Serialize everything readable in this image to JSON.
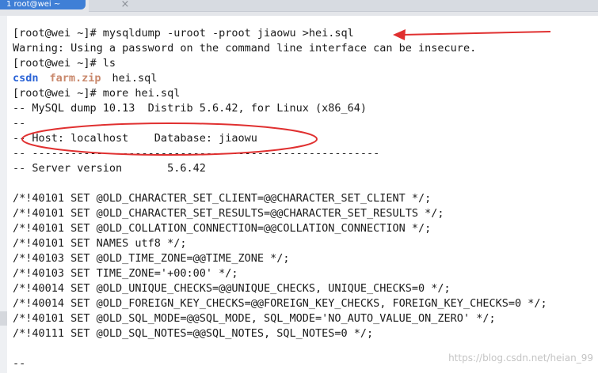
{
  "tabs": [
    {
      "label": "1 root@wei ~"
    }
  ],
  "tab_close_icon": "close-icon",
  "terminal": {
    "lines": [
      {
        "text": "[root@wei ~]# mysqldump -uroot -proot jiaowu >hei.sql"
      },
      {
        "text": "Warning: Using a password on the command line interface can be insecure."
      },
      {
        "text": "[root@wei ~]# ls"
      },
      {
        "ls": [
          {
            "text": "csdn",
            "kind": "directory",
            "color": "#2a63d6"
          },
          {
            "text": "farm.zip",
            "kind": "archive",
            "color": "#c9886c"
          },
          {
            "text": "hei.sql",
            "kind": "file",
            "color": "#1a1a1a"
          }
        ]
      },
      {
        "text": "[root@wei ~]# more hei.sql"
      },
      {
        "text": "-- MySQL dump 10.13  Distrib 5.6.42, for Linux (x86_64)"
      },
      {
        "text": "--"
      },
      {
        "text": "-- Host: localhost    Database: jiaowu"
      },
      {
        "text": "-- ------------------------------------------------------"
      },
      {
        "text": "-- Server version\t5.6.42"
      },
      {
        "text": ""
      },
      {
        "text": "/*!40101 SET @OLD_CHARACTER_SET_CLIENT=@@CHARACTER_SET_CLIENT */;"
      },
      {
        "text": "/*!40101 SET @OLD_CHARACTER_SET_RESULTS=@@CHARACTER_SET_RESULTS */;"
      },
      {
        "text": "/*!40101 SET @OLD_COLLATION_CONNECTION=@@COLLATION_CONNECTION */;"
      },
      {
        "text": "/*!40101 SET NAMES utf8 */;"
      },
      {
        "text": "/*!40103 SET @OLD_TIME_ZONE=@@TIME_ZONE */;"
      },
      {
        "text": "/*!40103 SET TIME_ZONE='+00:00' */;"
      },
      {
        "text": "/*!40014 SET @OLD_UNIQUE_CHECKS=@@UNIQUE_CHECKS, UNIQUE_CHECKS=0 */;"
      },
      {
        "text": "/*!40014 SET @OLD_FOREIGN_KEY_CHECKS=@@FOREIGN_KEY_CHECKS, FOREIGN_KEY_CHECKS=0 */;"
      },
      {
        "text": "/*!40101 SET @OLD_SQL_MODE=@@SQL_MODE, SQL_MODE='NO_AUTO_VALUE_ON_ZERO' */;"
      },
      {
        "text": "/*!40111 SET @OLD_SQL_NOTES=@@SQL_NOTES, SQL_NOTES=0 */;"
      },
      {
        "text": ""
      },
      {
        "text": "--"
      }
    ]
  },
  "annotation_color": "#e03030",
  "watermark": "https://blog.csdn.net/heian_99"
}
